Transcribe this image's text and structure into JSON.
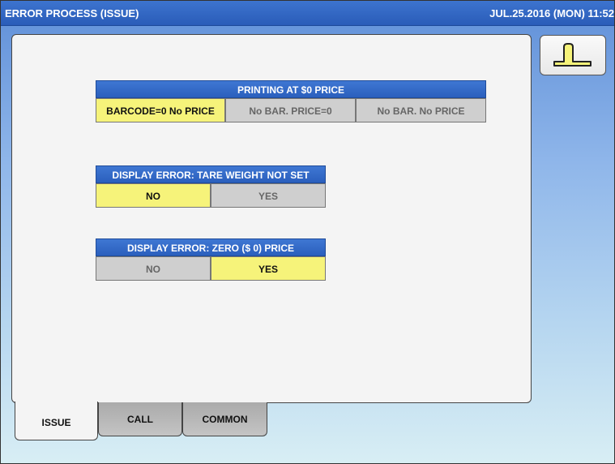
{
  "header": {
    "title": "ERROR PROCESS (ISSUE)",
    "datetime": "JUL.25.2016 (MON) 11:52"
  },
  "back_button": {
    "icon": "return-arrow-icon"
  },
  "groups": {
    "printing": {
      "title": "PRINTING AT $0 PRICE",
      "options": [
        "BARCODE=0 No PRICE",
        "No BAR. PRICE=0",
        "No BAR. No PRICE"
      ],
      "selected": 0
    },
    "tare": {
      "title": "DISPLAY ERROR: TARE WEIGHT NOT SET",
      "options": [
        "NO",
        "YES"
      ],
      "selected": 0
    },
    "zero_price": {
      "title": "DISPLAY ERROR: ZERO ($ 0) PRICE",
      "options": [
        "NO",
        "YES"
      ],
      "selected": 1
    }
  },
  "tabs": [
    {
      "label": "ISSUE",
      "active": true
    },
    {
      "label": "CALL",
      "active": false
    },
    {
      "label": "COMMON",
      "active": false
    }
  ],
  "colors": {
    "selected": "#f6f37a",
    "unselected": "#cfcfcf",
    "header_blue": "#2b5fbd"
  }
}
